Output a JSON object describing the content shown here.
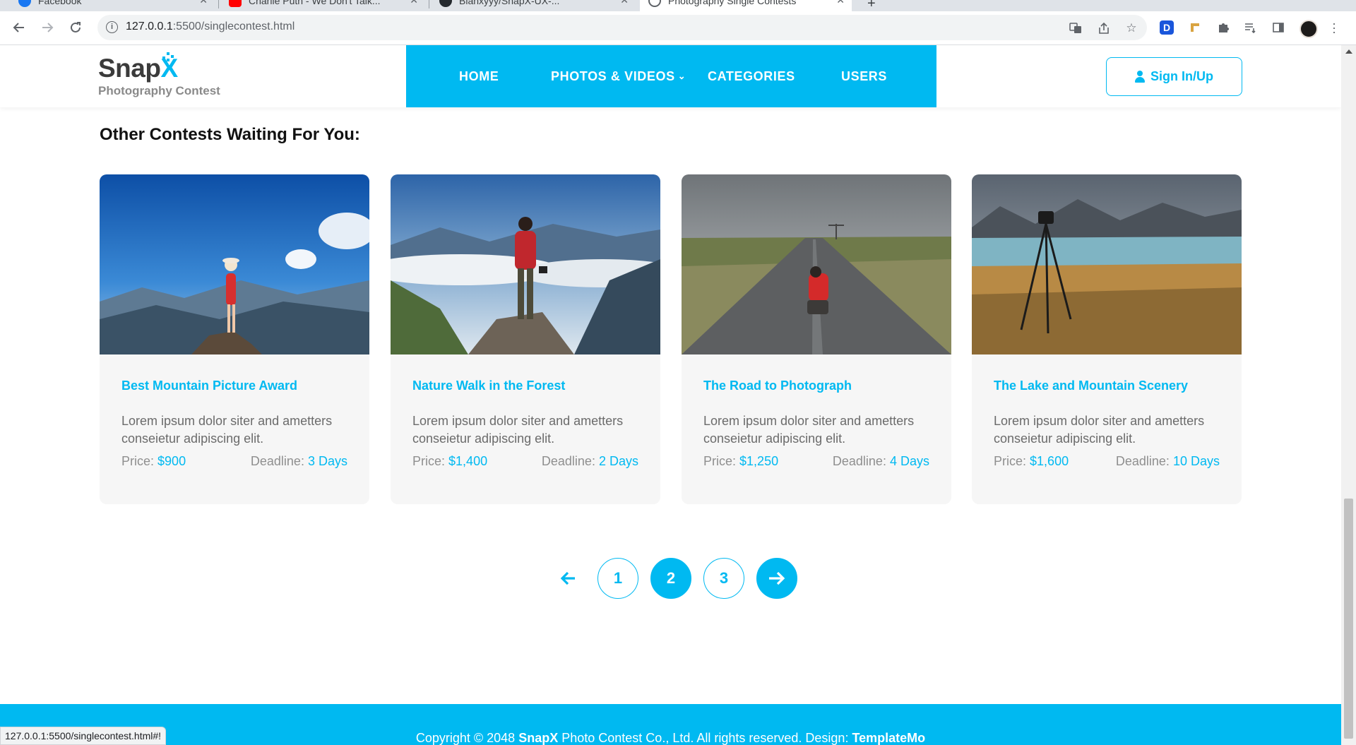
{
  "browser": {
    "tabs": [
      {
        "title": "Facebook",
        "icon": "facebook-icon",
        "color": "#1877f2"
      },
      {
        "title": "Charlie Puth - We Don't Talk...",
        "icon": "youtube-icon",
        "color": "#ff0000"
      },
      {
        "title": "Blanxyyy/SnapX-UX-...",
        "icon": "github-icon",
        "color": "#24292e"
      },
      {
        "title": "Photography Single Contests",
        "icon": "globe-icon",
        "color": "#5f6368"
      }
    ],
    "url_host": "127.0.0.1",
    "url_path": ":5500/singlecontest.html",
    "status_url": "127.0.0.1:5500/singlecontest.html#!"
  },
  "site": {
    "logo_name": "Snap",
    "logo_accent": "X",
    "logo_tagline": "Photography Contest",
    "accent_color": "#00b9f1",
    "nav": [
      {
        "label": "HOME"
      },
      {
        "label": "PHOTOS & VIDEOS",
        "has_dropdown": true
      },
      {
        "label": "CATEGORIES"
      },
      {
        "label": "USERS"
      }
    ],
    "signin_label": "Sign In/Up"
  },
  "section": {
    "title": "Other Contests Waiting For You:"
  },
  "contests": [
    {
      "title": "Best Mountain Picture Award",
      "description": "Lorem ipsum dolor siter and ametters conseietur adipiscing elit.",
      "price_label": "Price:",
      "price": "$900",
      "deadline_label": "Deadline:",
      "deadline": "3 Days",
      "image": "woman-on-mountain"
    },
    {
      "title": "Nature Walk in the Forest",
      "description": "Lorem ipsum dolor siter and ametters conseietur adipiscing elit.",
      "price_label": "Price:",
      "price": "$1,400",
      "deadline_label": "Deadline:",
      "deadline": "2 Days",
      "image": "hiker-above-clouds"
    },
    {
      "title": "The Road to Photograph",
      "description": "Lorem ipsum dolor siter and ametters conseietur adipiscing elit.",
      "price_label": "Price:",
      "price": "$1,250",
      "deadline_label": "Deadline:",
      "deadline": "4 Days",
      "image": "photographer-on-road"
    },
    {
      "title": "The Lake and Mountain Scenery",
      "description": "Lorem ipsum dolor siter and ametters conseietur adipiscing elit.",
      "price_label": "Price:",
      "price": "$1,600",
      "deadline_label": "Deadline:",
      "deadline": "10 Days",
      "image": "tripod-by-lake"
    }
  ],
  "pagination": {
    "prev_icon": "arrow-left-icon",
    "pages": [
      "1",
      "2",
      "3"
    ],
    "current": "2",
    "next_icon": "arrow-right-icon"
  },
  "footer": {
    "prefix": "Copyright © 2048",
    "brand": "SnapX",
    "middle": "Photo Contest Co., Ltd. All rights reserved. Design:",
    "designer": "TemplateMo"
  }
}
